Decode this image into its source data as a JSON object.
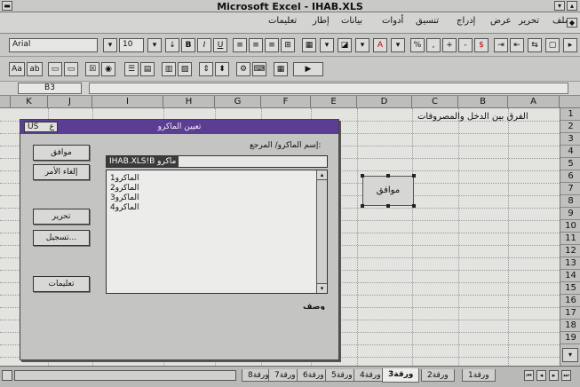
{
  "window": {
    "title": "Microsoft Excel - IHAB.XLS"
  },
  "menubar": {
    "items": [
      "ملف",
      "تحرير",
      "عرض",
      "إدراج",
      "تنسيق",
      "أدوات",
      "بيانات",
      "إطار",
      "تعليمات"
    ]
  },
  "toolbar": {
    "font_name": "Arial",
    "font_size": "10",
    "bold": "B",
    "italic": "I",
    "underline": "U"
  },
  "formula_bar": {
    "cell_ref": "B3",
    "content": ""
  },
  "sheet": {
    "columns": [
      "K",
      "J",
      "I",
      "H",
      "G",
      "F",
      "E",
      "D",
      "C",
      "B",
      "A"
    ],
    "rows": [
      "1",
      "2",
      "3",
      "4",
      "5",
      "6",
      "7",
      "8",
      "9",
      "10",
      "11",
      "12",
      "13",
      "14",
      "15",
      "16",
      "17",
      "18",
      "19"
    ],
    "cell_a1": "الفرق بين الدخل والمصروفات",
    "button_label": "موافق"
  },
  "dialog": {
    "title": "تعيين الماكرو",
    "sys_box": "US",
    "ok": "موافق",
    "cancel": "إلغاء الأمر",
    "edit": "تحرير",
    "record": "تسجيل...",
    "help": "تعليمات",
    "macro_label": "إسم الماكرو/ المرجع:",
    "macro_value": "IHAB.XLS!B ماكرو",
    "macros": [
      "الماكرو1",
      "الماكرو2",
      "الماكرو3",
      "الماكرو4"
    ],
    "description_label": "وصف"
  },
  "tabs": {
    "items": [
      "ورقة1",
      "ورقة2",
      "ورقة3",
      "ورقة4",
      "ورقة5",
      "ورقة6",
      "ورقة7",
      "ورقة8"
    ],
    "active": "ورقة3"
  },
  "colors": {
    "dialog_title": "#5b3d93",
    "background": "#9a9a98"
  }
}
